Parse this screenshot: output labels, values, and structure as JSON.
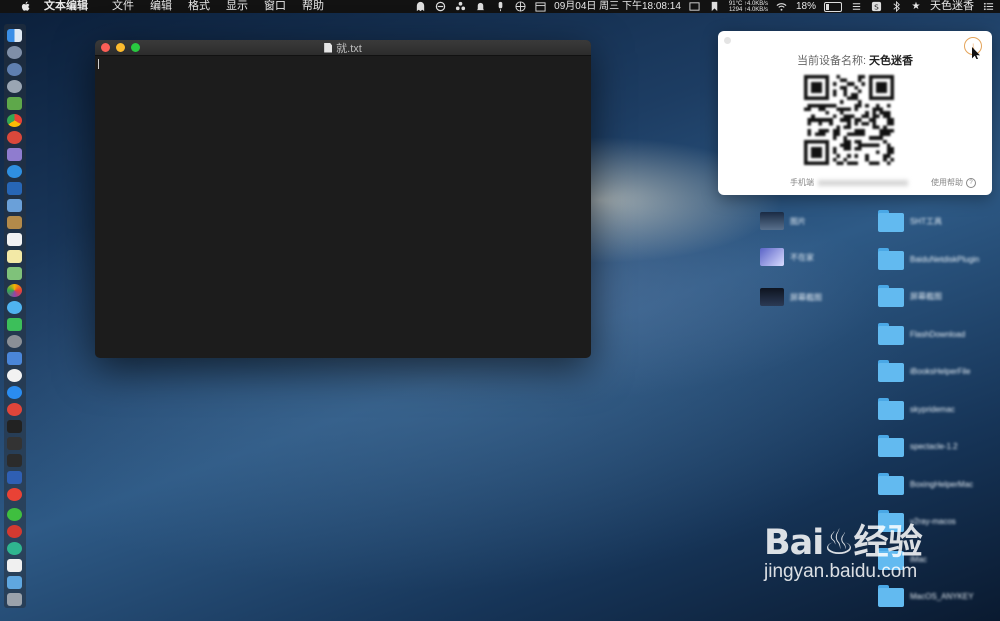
{
  "menubar": {
    "app_name": "文本编辑",
    "items": [
      "文件",
      "编辑",
      "格式",
      "显示",
      "窗口",
      "帮助"
    ],
    "datetime": "09月04日 周三 下午18:08:14",
    "net_up": "1294 ↑4.0KB/s",
    "net_down": "91°C ↑4.0KB/s",
    "battery_percent": "18%",
    "battery_level": 0.18,
    "user": "天色迷香"
  },
  "editor_window": {
    "title": "就.txt",
    "content": ""
  },
  "popup": {
    "device_label": "当前设备名称:",
    "device_name": "天色迷香",
    "phone_label": "手机端",
    "help_label": "使用帮助"
  },
  "desktop_items": [
    {
      "label": "图片"
    },
    {
      "label": "不在家"
    },
    {
      "label": "屏幕截图"
    }
  ],
  "folders": [
    {
      "label": "SHT工具"
    },
    {
      "label": "BaiduNetdiskPlugin"
    },
    {
      "label": "屏幕截图"
    },
    {
      "label": "FlashDownload"
    },
    {
      "label": "iBooksHelperFile"
    },
    {
      "label": "skypridemac"
    },
    {
      "label": "spectacle-1.2"
    },
    {
      "label": "BoxingHelperMac"
    },
    {
      "label": "v2ray-macos"
    },
    {
      "label": "iMac"
    },
    {
      "label": "MacOS_ANYKEY"
    }
  ],
  "watermark": {
    "logo": "Bai♨经验",
    "url": "jingyan.baidu.com"
  },
  "colors": {
    "menubar_bg": "#121212",
    "window_bg": "#1c1c1c",
    "folder_blue": "#62baf0",
    "accent_orange": "#e48a30"
  }
}
